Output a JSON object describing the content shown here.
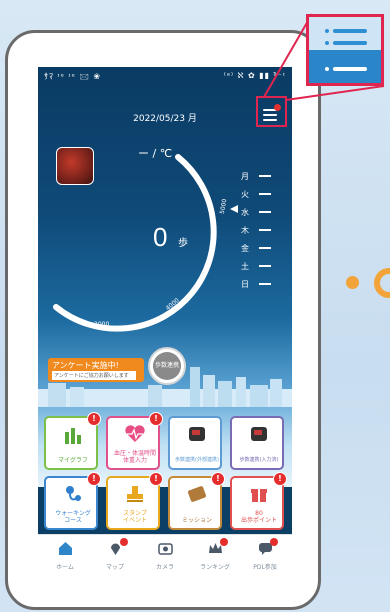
{
  "status_bar": {
    "left": "ｻﾏ ᶦᵉ ᶦᵉ 🖂 ❀",
    "right": "⁽ᵃ⁾ ℵ ✿ ▮▮ ᵃ̄⁻ᶦ"
  },
  "header": {
    "date": "2022/05/23 月"
  },
  "weather": {
    "temp": "ー / ℃"
  },
  "steps": {
    "count": "0",
    "unit": "歩",
    "scale_min": "2000",
    "scale_mid": "4000",
    "scale_right": "5000"
  },
  "week": [
    {
      "day": "月",
      "value": "ー"
    },
    {
      "day": "火",
      "value": "ー"
    },
    {
      "day": "水",
      "value": "ー"
    },
    {
      "day": "木",
      "value": "ー"
    },
    {
      "day": "金",
      "value": "ー"
    },
    {
      "day": "土",
      "value": "ー"
    },
    {
      "day": "日",
      "value": "ー"
    }
  ],
  "survey": {
    "title": "アンケート実施中!",
    "sub": "アンケートにご協力お願いします",
    "button": "歩数連携"
  },
  "tiles": [
    {
      "label": "マイグラフ",
      "badge": "!",
      "color": "#7cc04a"
    },
    {
      "label": "血圧・体温時間\n体重入力",
      "badge": "!",
      "color": "#e0508a"
    },
    {
      "label": "歩数連携(外部連携)",
      "badge": "",
      "color": "#5e9bd4"
    },
    {
      "label": "歩数連携(入力済)",
      "badge": "",
      "color": "#7a6bb5"
    },
    {
      "label": "ウォーキング\nコース",
      "badge": "!",
      "color": "#3a87cf"
    },
    {
      "label": "スタンプ\nイベント",
      "badge": "!",
      "color": "#e8a81e"
    },
    {
      "label": "ミッション",
      "badge": "!",
      "color": "#c48a3a"
    },
    {
      "label": "80\n出歩ポイント",
      "badge": "!",
      "color": "#e05050"
    }
  ],
  "tabs": [
    {
      "label": "ホーム",
      "icon": "home-icon",
      "badge": false
    },
    {
      "label": "マップ",
      "icon": "map-pin-icon",
      "badge": true
    },
    {
      "label": "カメラ",
      "icon": "camera-icon",
      "badge": false
    },
    {
      "label": "ランキング",
      "icon": "crown-icon",
      "badge": true
    },
    {
      "label": "PDL参加",
      "icon": "chat-icon",
      "badge": true
    }
  ],
  "colors": {
    "accent": "#e0264f",
    "badge": "#e52d2d",
    "orange": "#f08a1e"
  }
}
